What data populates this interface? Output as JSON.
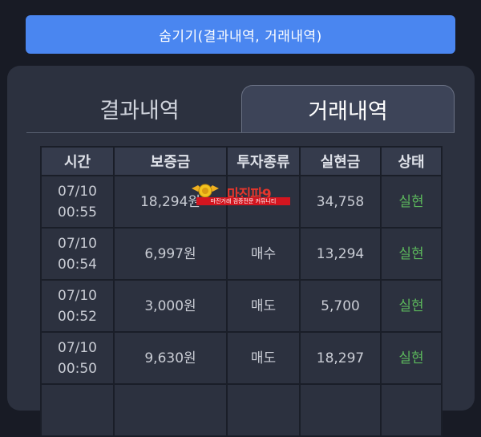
{
  "top_button": {
    "label": "숨기기(결과내역, 거래내역)"
  },
  "tabs": [
    {
      "label": "결과내역",
      "active": false
    },
    {
      "label": "거래내역",
      "active": true
    }
  ],
  "table": {
    "headers": [
      "시간",
      "보증금",
      "투자종류",
      "실현금",
      "상태"
    ],
    "rows": [
      {
        "date": "07/10",
        "time": "00:55",
        "deposit": "18,294원",
        "type": "",
        "realized": "34,758",
        "status": "실현"
      },
      {
        "date": "07/10",
        "time": "00:54",
        "deposit": "6,997원",
        "type": "매수",
        "realized": "13,294",
        "status": "실현"
      },
      {
        "date": "07/10",
        "time": "00:52",
        "deposit": "3,000원",
        "type": "매도",
        "realized": "5,700",
        "status": "실현"
      },
      {
        "date": "07/10",
        "time": "00:50",
        "deposit": "9,630원",
        "type": "매도",
        "realized": "18,297",
        "status": "실현"
      }
    ]
  },
  "watermark": {
    "title": "마진파9",
    "caption": "마진거래 검증전문 커뮤니티"
  },
  "colors": {
    "accent": "#4a86f0",
    "status_ok": "#5cb85c",
    "panel": "#2c313f",
    "background": "#181b25"
  }
}
